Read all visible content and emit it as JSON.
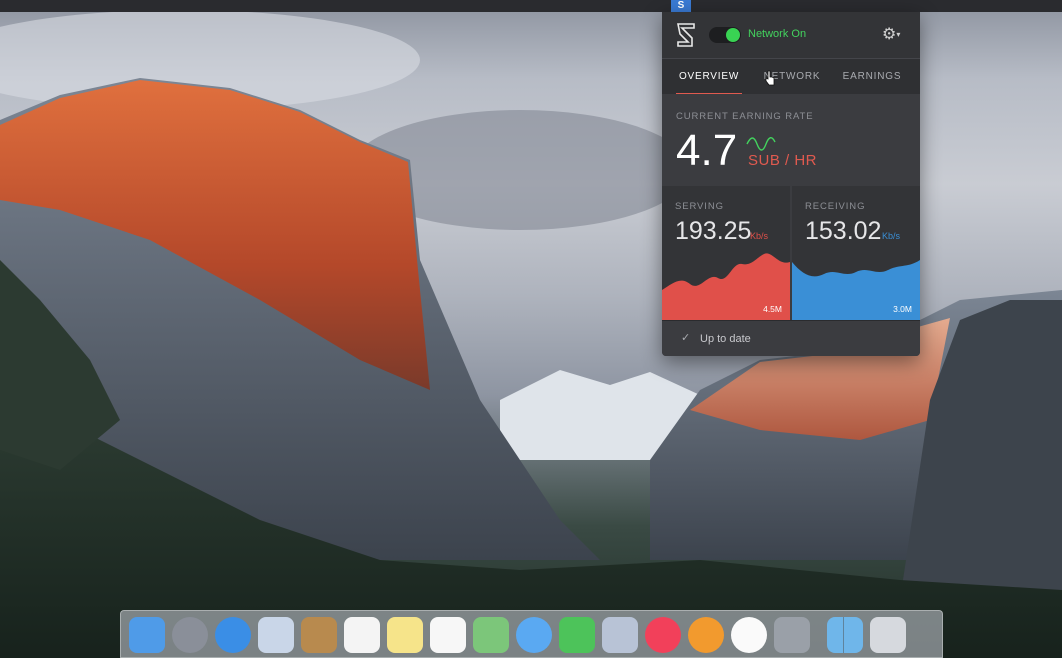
{
  "menubar": {
    "app_icon": "S"
  },
  "popover": {
    "header": {
      "logo_icon": "s-logo-icon",
      "network_status": "Network On",
      "toggle_on": true,
      "settings_icon": "gear-icon"
    },
    "tabs": [
      {
        "label": "OVERVIEW",
        "active": true
      },
      {
        "label": "NETWORK",
        "active": false
      },
      {
        "label": "EARNINGS",
        "active": false
      }
    ],
    "earning": {
      "caption": "CURRENT EARNING RATE",
      "value": "4.7",
      "unit": "SUB / HR"
    },
    "serving": {
      "caption": "SERVING",
      "value": "193.25",
      "unit": "Kb/s",
      "max": "4.5M",
      "color": "#e0504a"
    },
    "receiving": {
      "caption": "RECEIVING",
      "value": "153.02",
      "unit": "Kb/s",
      "max": "3.0M",
      "color": "#3a8fd6"
    },
    "status": {
      "icon": "checkmark-icon",
      "text": "Up to date"
    }
  },
  "dock": {
    "items": [
      {
        "name": "finder",
        "color": "#4f9be8"
      },
      {
        "name": "launchpad",
        "color": "#8a8f99"
      },
      {
        "name": "safari",
        "color": "#3a8ee6"
      },
      {
        "name": "mail",
        "color": "#c9d6e8"
      },
      {
        "name": "contacts",
        "color": "#b88a4e"
      },
      {
        "name": "calendar",
        "color": "#f4f4f4"
      },
      {
        "name": "notes",
        "color": "#f6e48a"
      },
      {
        "name": "reminders",
        "color": "#f7f7f7"
      },
      {
        "name": "maps",
        "color": "#7cc67a"
      },
      {
        "name": "messages",
        "color": "#5aa9f2"
      },
      {
        "name": "facetime",
        "color": "#4dc35a"
      },
      {
        "name": "photo-booth",
        "color": "#b8c3d6"
      },
      {
        "name": "itunes",
        "color": "#f2405a"
      },
      {
        "name": "ibooks",
        "color": "#f29a2e"
      },
      {
        "name": "app-store",
        "color": "#fafafa"
      },
      {
        "name": "system-preferences",
        "color": "#9aa0a8"
      },
      {
        "name": "downloads-folder",
        "color": "#6fb6ea"
      },
      {
        "name": "trash",
        "color": "#d6d9de"
      }
    ]
  }
}
